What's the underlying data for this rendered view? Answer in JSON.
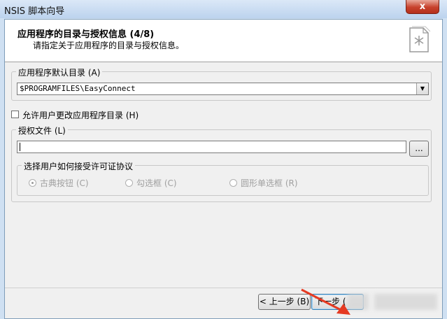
{
  "window": {
    "title": "NSIS 脚本向导",
    "close_glyph": "x"
  },
  "header": {
    "title": "应用程序的目录与授权信息 (4/8)",
    "subtitle": "请指定关于应用程序的目录与授权信息。",
    "icon": "wizard-page-icon"
  },
  "directory_group": {
    "legend": "应用程序默认目录 (A)",
    "value": "$PROGRAMFILES\\EasyConnect"
  },
  "allow_change": {
    "label": "允许用户更改应用程序目录 (H)",
    "checked": false
  },
  "license_group": {
    "legend": "授权文件 (L)",
    "value": "",
    "browse_label": "..."
  },
  "accept_group": {
    "legend": "选择用户如何接受许可证协议",
    "options": [
      {
        "label": "古典按钮 (C)",
        "selected": true
      },
      {
        "label": "勾选框 (C)",
        "selected": false
      },
      {
        "label": "圆形单选框 (R)",
        "selected": false
      }
    ]
  },
  "buttons": {
    "back": "< 上一步 (B)",
    "next": "下一步 ("
  },
  "colors": {
    "annotation_arrow": "#e53a22"
  }
}
